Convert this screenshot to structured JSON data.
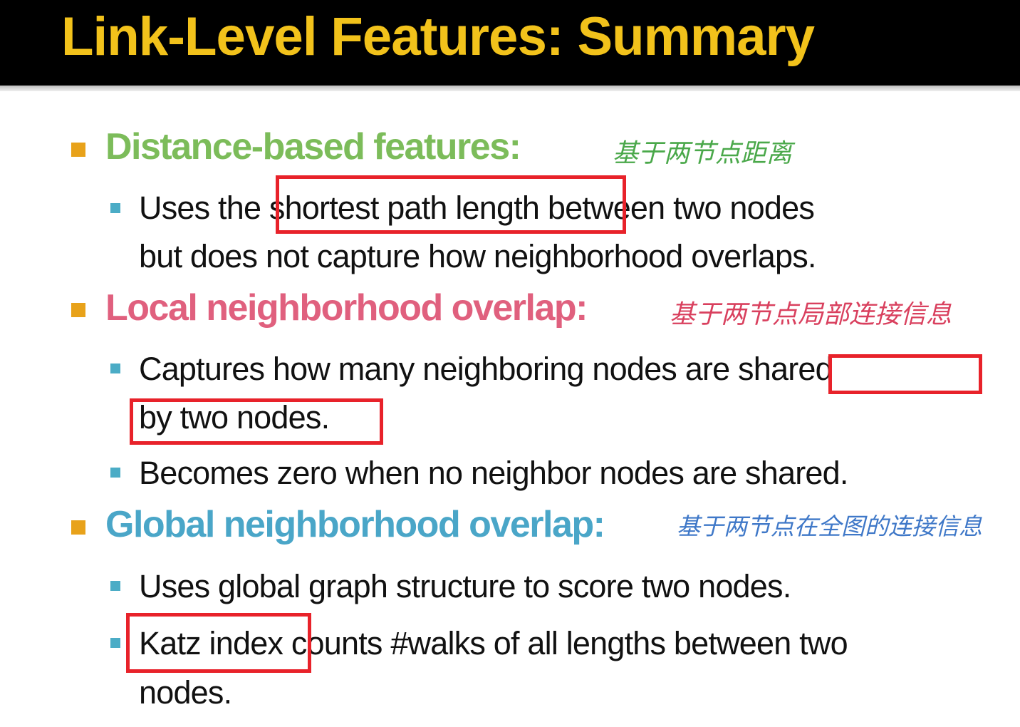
{
  "title": "Link-Level Features: Summary",
  "colors": {
    "title": "#f2c21b",
    "distance": "#7cbc5a",
    "local": "#e0607e",
    "global": "#4aa6c8",
    "highlight_box": "#e8222a"
  },
  "sections": [
    {
      "heading": "Distance-based features:",
      "note": "基于两节点距离",
      "bullets": [
        "Uses the shortest path length between two nodes",
        "but does not capture how neighborhood overlaps."
      ]
    },
    {
      "heading": "Local neighborhood overlap:",
      "note": "基于两节点局部连接信息",
      "bullets": [
        "Captures how many neighboring nodes are shared",
        "by two nodes.",
        "Becomes zero when no neighbor nodes are shared."
      ]
    },
    {
      "heading": "Global neighborhood overlap:",
      "note": "基于两节点在全图的连接信息",
      "bullets": [
        "Uses global graph structure to score two nodes.",
        "Katz index counts #walks of all lengths between two",
        "nodes."
      ]
    }
  ],
  "highlights": [
    "shortest path length",
    "shared",
    "by two nodes.",
    "Katz index"
  ]
}
